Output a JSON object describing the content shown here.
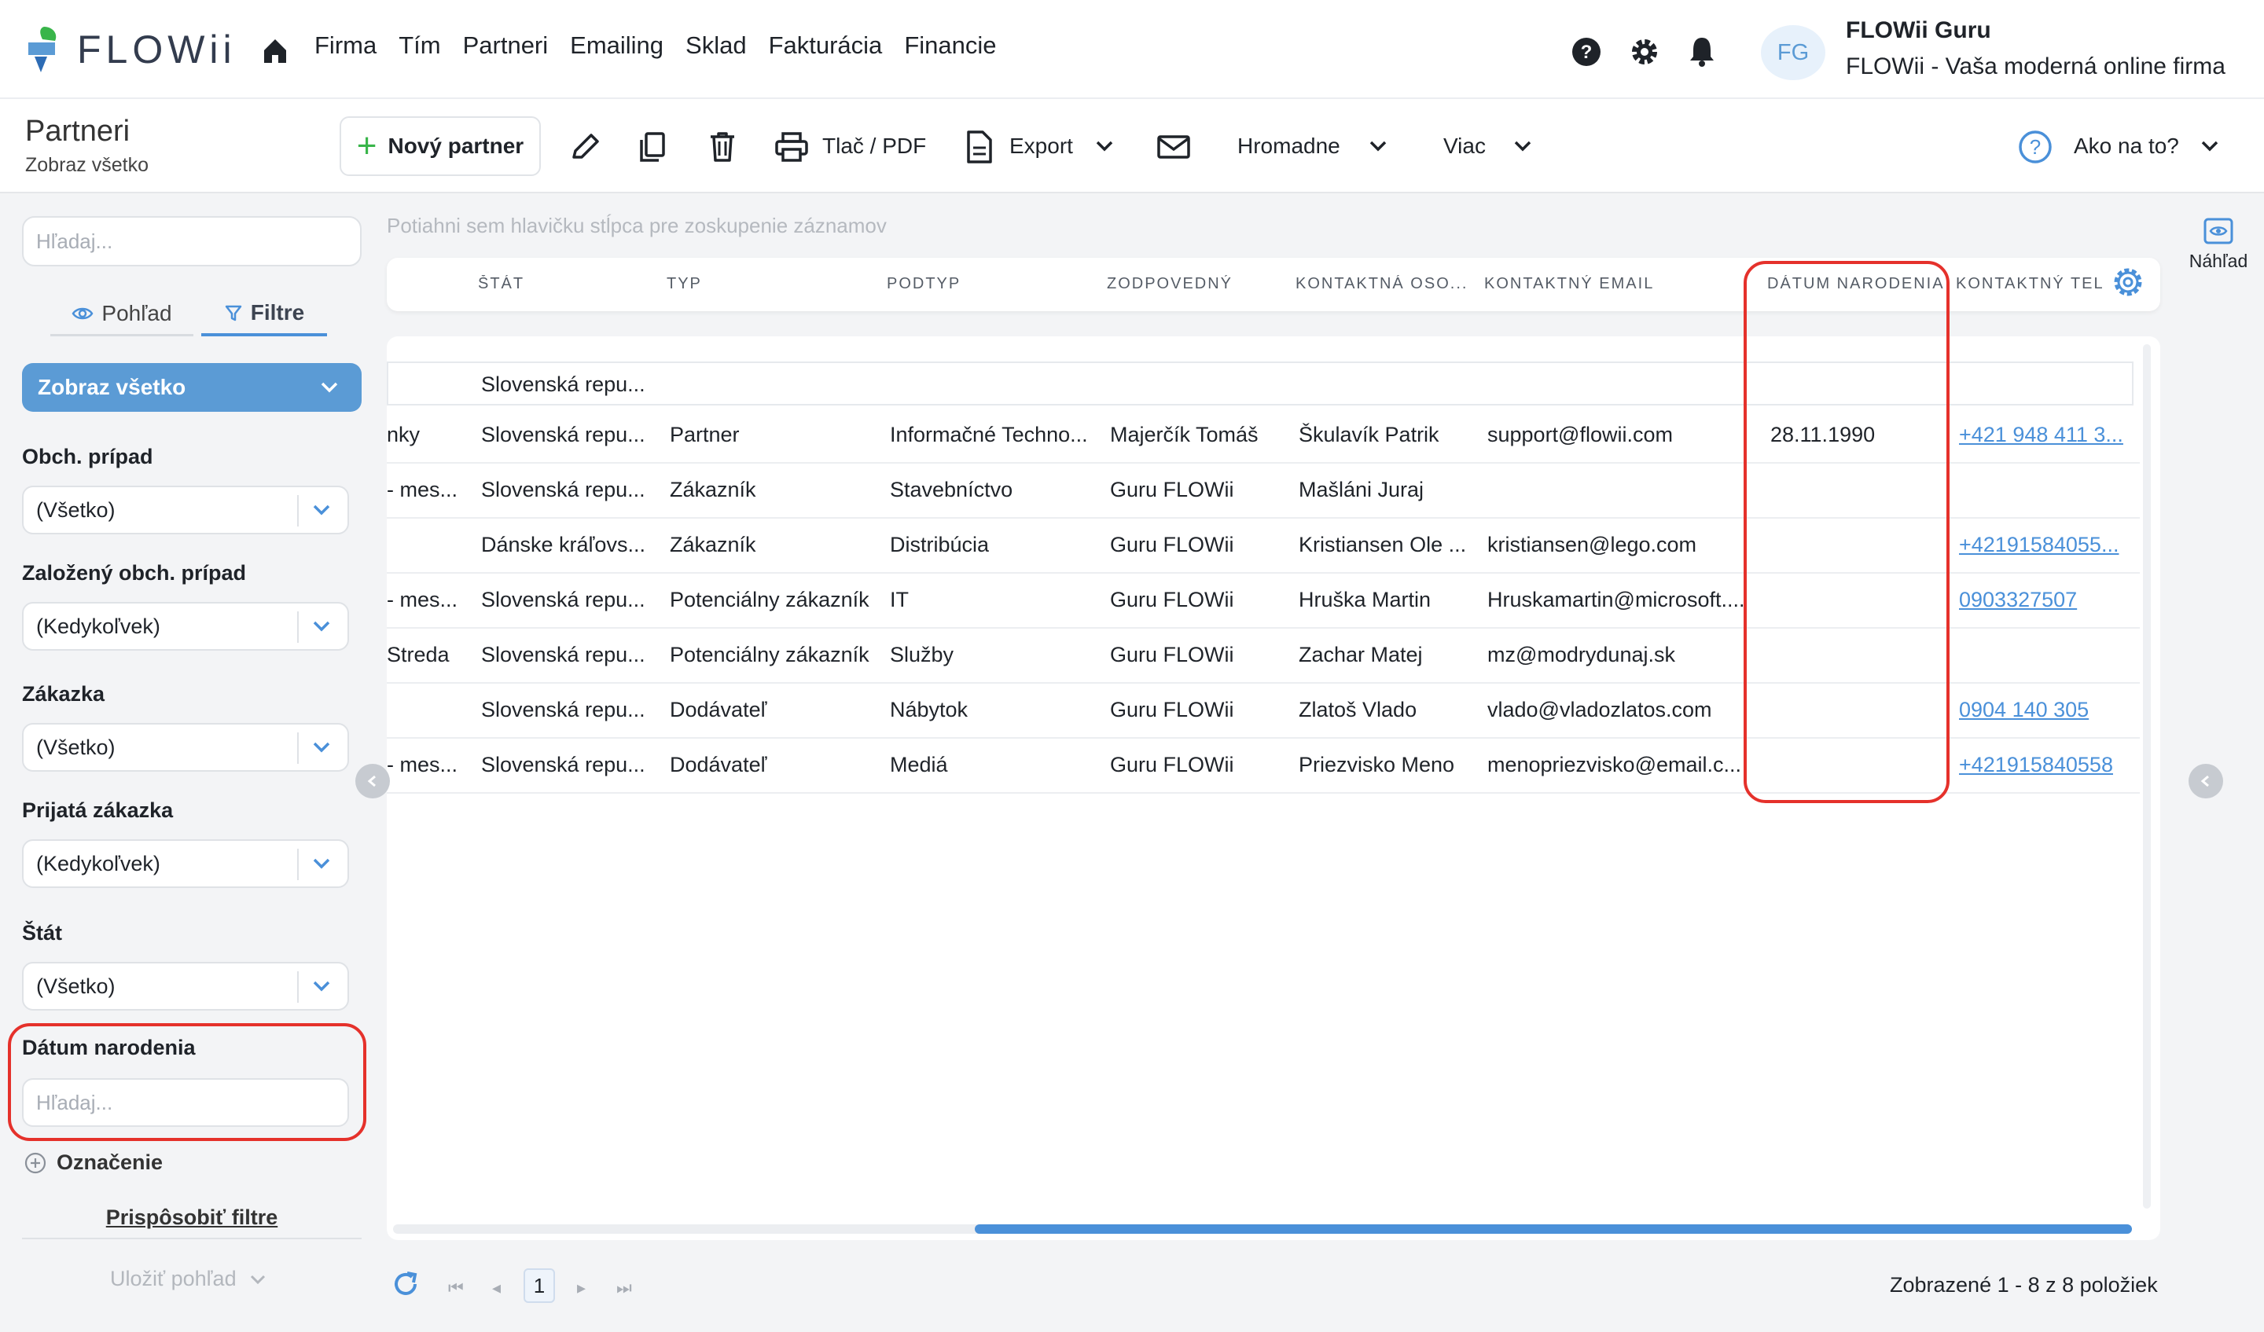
{
  "app": {
    "brand": "FLOWii",
    "accent_color": "#5b9bd5",
    "highlight_color": "#e5312b"
  },
  "nav": {
    "items": [
      "Firma",
      "Tím",
      "Partneri",
      "Emailing",
      "Sklad",
      "Fakturácia",
      "Financie"
    ]
  },
  "user": {
    "initials": "FG",
    "name": "FLOWii Guru",
    "company": "FLOWii - Vaša moderná online firma"
  },
  "page": {
    "title": "Partneri",
    "subtitle": "Zobraz všetko"
  },
  "toolbar": {
    "new_label": "Nový partner",
    "print_label": "Tlač / PDF",
    "export_label": "Export",
    "bulk_label": "Hromadne",
    "more_label": "Viac",
    "help_label": "Ako na to?"
  },
  "sidebar": {
    "search_placeholder": "Hľadaj...",
    "tab_view": "Pohľad",
    "tab_filters": "Filtre",
    "view_select": "Zobraz všetko",
    "filters": [
      {
        "label": "Obch. prípad",
        "value": "(Všetko)"
      },
      {
        "label": "Založený obch. prípad",
        "value": "(Kedykoľvek)"
      },
      {
        "label": "Zákazka",
        "value": "(Všetko)"
      },
      {
        "label": "Prijatá zákazka",
        "value": "(Kedykoľvek)"
      },
      {
        "label": "Štát",
        "value": "(Všetko)"
      }
    ],
    "date_filter_label": "Dátum narodenia",
    "date_filter_placeholder": "Hľadaj...",
    "tag_label": "Označenie",
    "customize_label": "Prispôsobiť filtre",
    "save_view_label": "Uložiť pohľad"
  },
  "grid": {
    "group_hint": "Potiahni sem hlavičku stĺpca pre zoskupenie záznamov",
    "columns": [
      "ŠTÁT",
      "TYP",
      "PODTYP",
      "ZODPOVEDNÝ",
      "KONTAKTNÁ OSO...",
      "KONTAKTNÝ EMAIL",
      "DÁTUM NARODENIA",
      "KONTAKTNÝ TELE"
    ],
    "filter_row_state": "Slovenská repu...",
    "rows": [
      [
        "nky",
        "Slovenská repu...",
        "Partner",
        "Informačné Techno...",
        "Majerčík Tomáš",
        "Škulavík Patrik",
        "support@flowii.com",
        "28.11.1990",
        "+421 948 411 3..."
      ],
      [
        "- mes...",
        "Slovenská repu...",
        "Zákazník",
        "Stavebníctvo",
        "Guru FLOWii",
        "Mašláni Juraj",
        "",
        "",
        ""
      ],
      [
        "",
        "Dánske kráľovs...",
        "Zákazník",
        "Distribúcia",
        "Guru FLOWii",
        "Kristiansen Ole ...",
        "kristiansen@lego.com",
        "",
        "+42191584055..."
      ],
      [
        "- mes...",
        "Slovenská repu...",
        "Potenciálny zákazník",
        "IT",
        "Guru FLOWii",
        "Hruška Martin",
        "Hruskamartin@microsoft....",
        "",
        "0903327507"
      ],
      [
        "Streda",
        "Slovenská repu...",
        "Potenciálny zákazník",
        "Služby",
        "Guru FLOWii",
        "Zachar Matej",
        "mz@modrydunaj.sk",
        "",
        ""
      ],
      [
        "",
        "Slovenská repu...",
        "Dodávateľ",
        "Nábytok",
        "Guru FLOWii",
        "Zlatoš Vlado",
        "vlado@vladozlatos.com",
        "",
        "0904 140 305"
      ],
      [
        "- mes...",
        "Slovenská repu...",
        "Dodávateľ",
        "Mediá",
        "Guru FLOWii",
        "Priezvisko Meno",
        "menopriezvisko@email.c...",
        "",
        "+421915840558"
      ]
    ]
  },
  "pager": {
    "current_page": "1",
    "info": "Zobrazené 1 - 8 z 8 položiek"
  },
  "preview": {
    "label": "Náhľad"
  }
}
